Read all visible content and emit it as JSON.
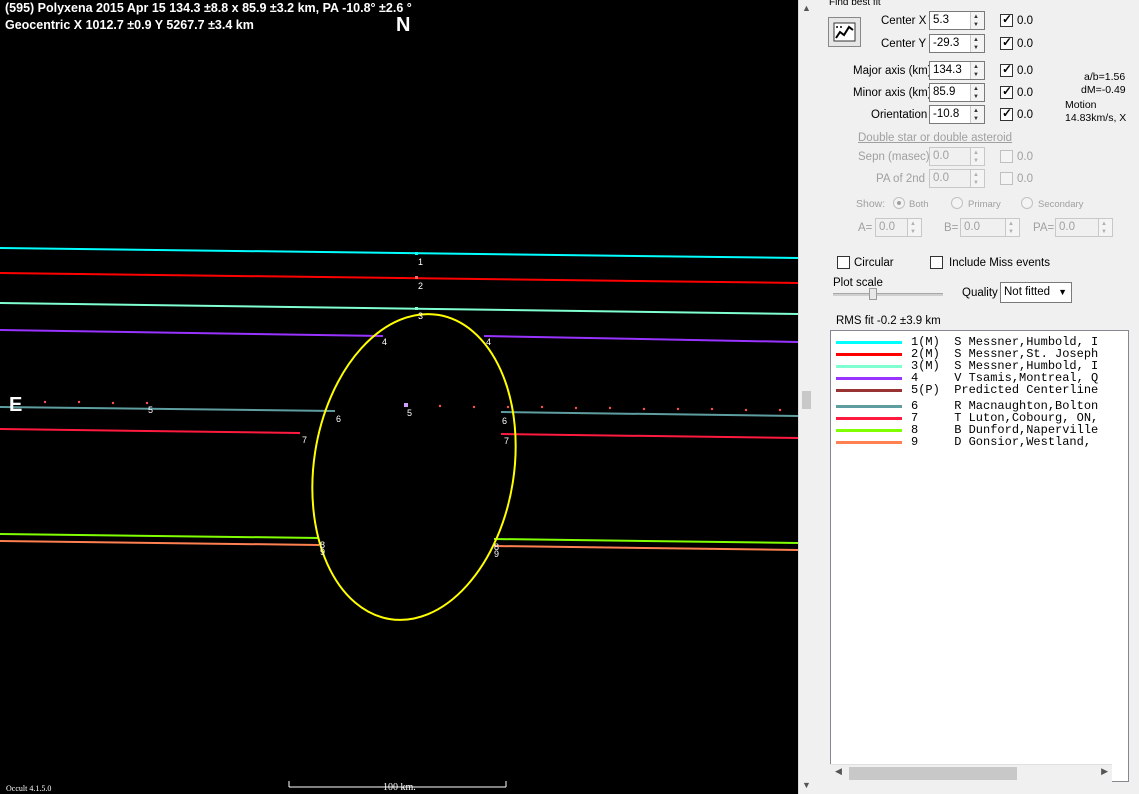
{
  "plot": {
    "header_line1": "(595) Polyxena  2015 Apr 15   134.3 ±8.8 x 85.9 ±3.2 km, PA -10.8° ±2.6 °",
    "header_line2": "Geocentric  X  1012.7 ±0.9  Y 5267.7 ±3.4 km",
    "north_label": "N",
    "east_label": "E",
    "version": "Occult 4.1.5.0",
    "scale_label": "100 km."
  },
  "panel": {
    "find_best_fit": "Find best fit",
    "center_x": {
      "label": "Center X",
      "value": "5.3",
      "checked": true,
      "step": "0.0"
    },
    "center_y": {
      "label": "Center Y",
      "value": "-29.3",
      "checked": true,
      "step": "0.0"
    },
    "major_axis": {
      "label": "Major axis (km)",
      "value": "134.3",
      "checked": true,
      "step": "0.0"
    },
    "minor_axis": {
      "label": "Minor axis (km)",
      "value": "85.9",
      "checked": true,
      "step": "0.0"
    },
    "orientation": {
      "label": "Orientation",
      "value": "-10.8",
      "checked": true,
      "step": "0.0"
    },
    "ratio_ab": "a/b=1.56",
    "dm": "dM=-0.49",
    "motion_label": "Motion",
    "motion_value": "14.83km/s, X",
    "double_star_link": "Double star  or  double asteroid",
    "sepn": {
      "label": "Sepn (masec)",
      "value": "0.0",
      "step": "0.0"
    },
    "pa2nd": {
      "label": "PA of 2nd",
      "value": "0.0",
      "step": "0.0"
    },
    "show_label": "Show:",
    "show_options": [
      "Both",
      "Primary",
      "Secondary"
    ],
    "a_label": "A=",
    "a_value": "0.0",
    "b_label": "B=",
    "b_value": "0.0",
    "pa_label": "PA=",
    "pa_value": "0.0",
    "circular_label": "Circular",
    "circular_checked": false,
    "include_miss_label": "Include Miss events",
    "include_miss_checked": false,
    "plot_scale_label": "Plot scale",
    "quality_label": "Quality",
    "quality_value": "Not fitted",
    "rms_fit": "RMS fit -0.2 ±3.9 km"
  },
  "observers": [
    {
      "text": "1(M)  S Messner,Humbold, I",
      "color": "#00ffff"
    },
    {
      "text": "2(M)  S Messner,St. Joseph",
      "color": "#ff0000"
    },
    {
      "text": "3(M)  S Messner,Humbold, I",
      "color": "#80ffd0"
    },
    {
      "text": "4     V Tsamis,Montreal, Q",
      "color": "#9933ff"
    },
    {
      "text": "5(P)  Predicted Centerline",
      "color": "#993333"
    },
    {
      "text": "6     R Macnaughton,Bolton",
      "color": "#5f9ea0"
    },
    {
      "text": "7     T Luton,Cobourg, ON,",
      "color": "#ff1a40"
    },
    {
      "text": "8     B Dunford,Naperville",
      "color": "#80ff00"
    },
    {
      "text": "9     D Gonsior,Westland,",
      "color": "#ff8050"
    }
  ],
  "chords": [
    {
      "label": "1",
      "color": "#00ffff"
    },
    {
      "label": "2",
      "color": "#ff0000"
    },
    {
      "label": "3",
      "color": "#80ffd0"
    },
    {
      "label": "4",
      "color": "#9933ff"
    },
    {
      "label": "5",
      "color": "#ff5050"
    },
    {
      "label": "6",
      "color": "#5f9ea0"
    },
    {
      "label": "7",
      "color": "#ff1a40"
    },
    {
      "label": "8",
      "color": "#80ff00"
    },
    {
      "label": "9",
      "color": "#ff8050"
    }
  ],
  "fit_ellipse_color": "#ffff00"
}
